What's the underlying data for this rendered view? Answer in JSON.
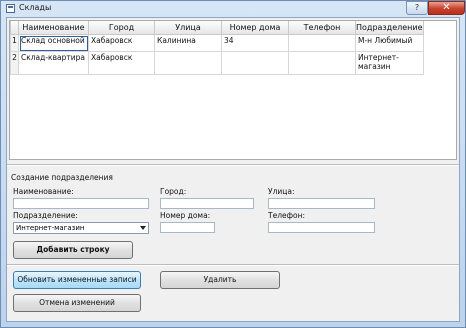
{
  "window": {
    "title": "Склады",
    "help_label": "?",
    "close_label": "✕"
  },
  "grid": {
    "columns": [
      "Наименование",
      "Город",
      "Улица",
      "Номер дома",
      "Телефон",
      "Подразделение"
    ],
    "rows": [
      {
        "num": "1",
        "cells": [
          "Склад основной",
          "Хабаровск",
          "Калинина",
          "34",
          "",
          "М-н Любимый"
        ]
      },
      {
        "num": "2",
        "cells": [
          "Склад-квартира",
          "Хабаровск",
          "",
          "",
          "",
          "Интернет-магазин"
        ]
      }
    ]
  },
  "form": {
    "group_title": "Создание подразделения",
    "name_label": "Наименование:",
    "city_label": "Город:",
    "street_label": "Улица:",
    "division_label": "Подразделение:",
    "house_label": "Номер дома:",
    "phone_label": "Телефон:",
    "division_value": "Интернет-магазин",
    "add_row": "Добавить строку"
  },
  "actions": {
    "update": "Обновить измененные записи",
    "delete": "Удалить",
    "cancel": "Отмена изменений"
  }
}
